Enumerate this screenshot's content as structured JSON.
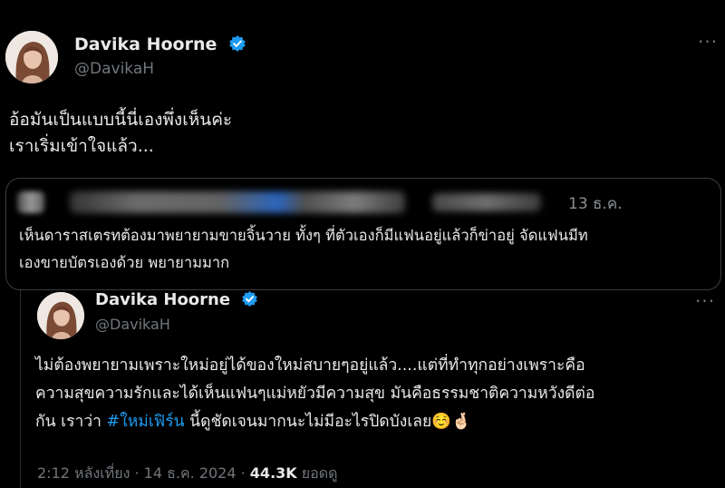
{
  "tweet": {
    "author_name": "Davika Hoorne",
    "author_handle": "@DavikaH",
    "more_label": "···",
    "text_lines": [
      "อ้อมันเป็นแบบนี้นี่เองพึ่งเห็นค่ะ",
      "เราเริ่มเข้าใจแล้ว..."
    ]
  },
  "quote": {
    "date": "13 ธ.ค.",
    "text_lines": [
      "เห็นดาราสเตรทต้องมาพยายามขายจิ้นวาย ทั้งๆ ที่ตัวเองก็มีแฟนอยู่แล้วก็ข่าอยู่ จัดแฟนมีท",
      "เองขายบัตรเองด้วย พยายามมาก"
    ]
  },
  "reply": {
    "author_name": "Davika Hoorne",
    "author_handle": "@DavikaH",
    "more_label": "···",
    "line1": "ไม่ต้องพยายามเพราะใหม่อยู่ได้ของใหม่สบายๆอยู่แล้ว....แต่ที่ทำทุกอย่างเพราะคือ",
    "line2": "ความสุขความรักและได้เห็นแฟนๆแม่หยัวมีความสุข มันคือธรรมชาติความหวังดีต่อ",
    "line3_before": "กัน เราว่า ",
    "hashtag": "#ใหม่เฟิร์น",
    "line3_after": " นี้ดูชัดเจนมากนะไม่มีอะไรปิดบังเลย",
    "emoji": "☺️🤞🏻",
    "time": "2:12 หลังเที่ยง · 14 ธ.ค. 2024 · ",
    "views_count": "44.3K",
    "views_label": " ยอดดู"
  },
  "colors": {
    "background": "#000000",
    "text": "#e7e9ea",
    "secondary": "#71767b",
    "accent": "#1d9bf0",
    "border": "#3a3d41"
  }
}
